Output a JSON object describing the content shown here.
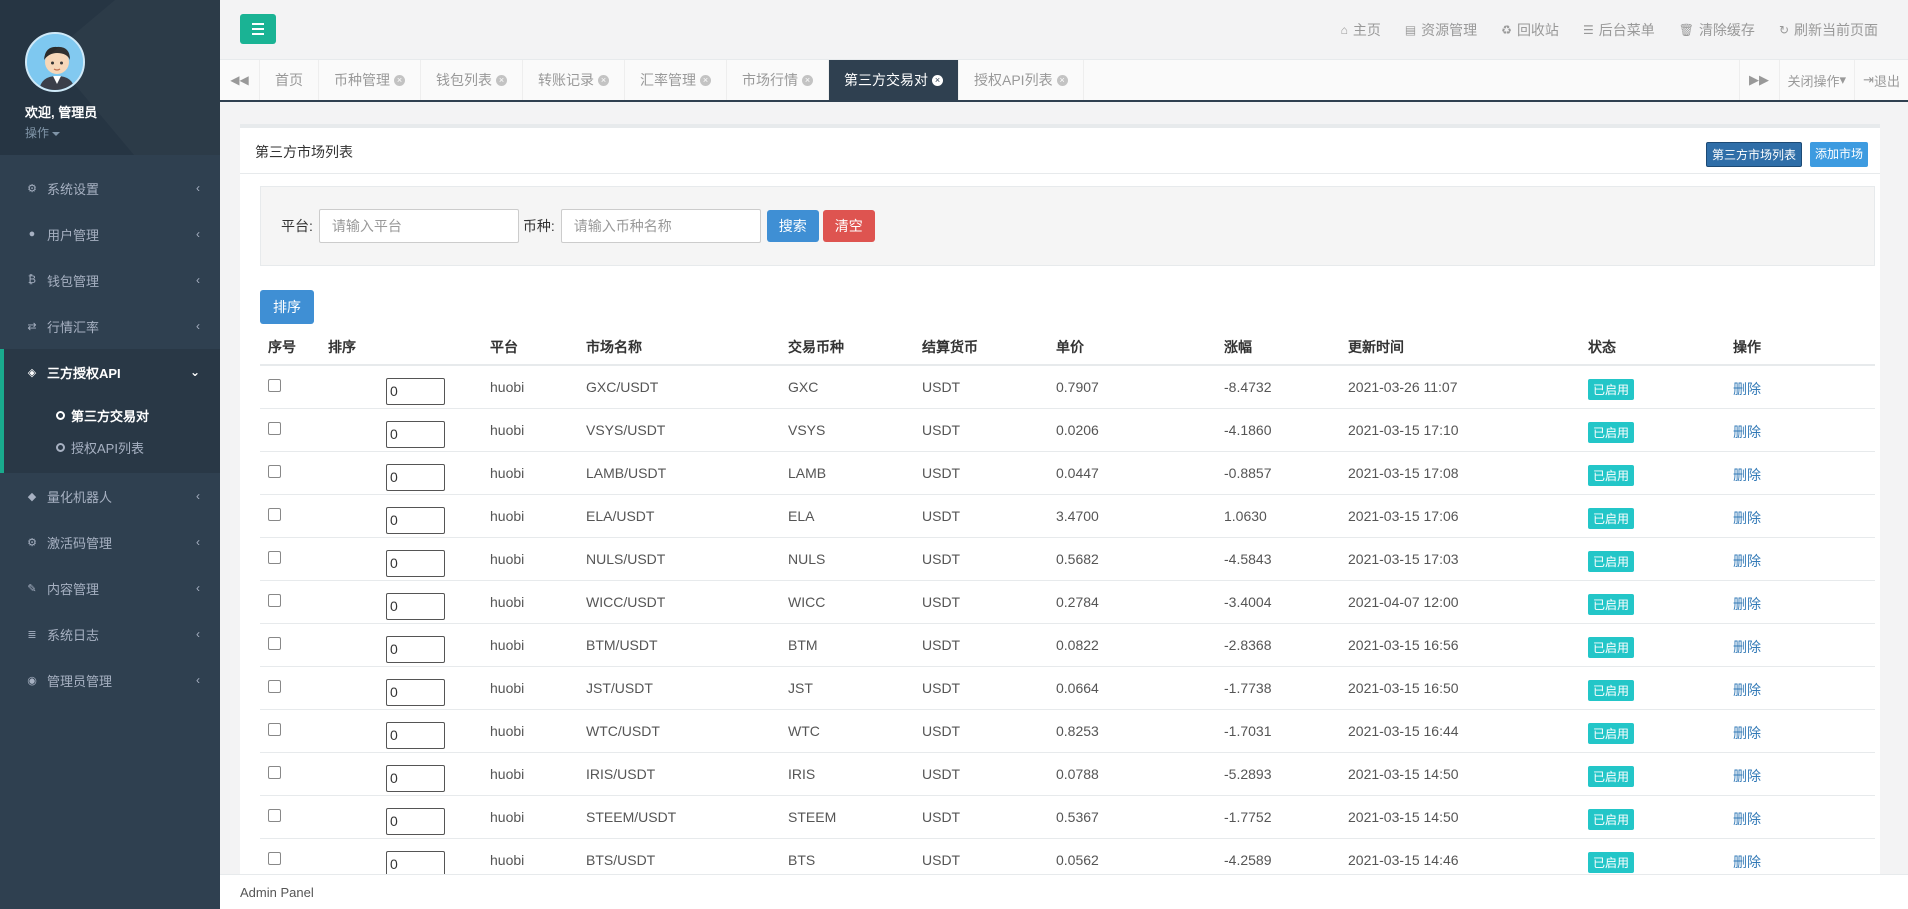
{
  "sidebar": {
    "welcome": "欢迎, 管理员",
    "ops_label": "操作",
    "menu": [
      {
        "label": "系统设置",
        "icon": "gears-icon"
      },
      {
        "label": "用户管理",
        "icon": "users-icon"
      },
      {
        "label": "钱包管理",
        "icon": "bitcoin-icon"
      },
      {
        "label": "行情汇率",
        "icon": "exchange-icon"
      },
      {
        "label": "三方授权API",
        "icon": "cube-icon"
      },
      {
        "label": "量化机器人",
        "icon": "robot-icon"
      },
      {
        "label": "激活码管理",
        "icon": "cog-icon"
      },
      {
        "label": "内容管理",
        "icon": "edit-icon"
      },
      {
        "label": "系统日志",
        "icon": "database-icon"
      },
      {
        "label": "管理员管理",
        "icon": "user-circle-icon"
      }
    ],
    "submenu": [
      "第三方交易对",
      "授权API列表"
    ]
  },
  "topbar": {
    "links": [
      "主页",
      "资源管理",
      "回收站",
      "后台菜单",
      "清除缓存",
      "刷新当前页面"
    ]
  },
  "tabs": [
    "首页",
    "币种管理",
    "钱包列表",
    "转账记录",
    "汇率管理",
    "市场行情",
    "第三方交易对",
    "授权API列表"
  ],
  "tabs_right": {
    "close_ops": "关闭操作",
    "logout": "退出"
  },
  "panel": {
    "title": "第三方市场列表",
    "btn_list": "第三方市场列表",
    "btn_add": "添加市场"
  },
  "search": {
    "platform_label": "平台:",
    "platform_placeholder": "请输入平台",
    "coin_label": "币种:",
    "coin_placeholder": "请输入币种名称",
    "search_btn": "搜索",
    "clear_btn": "清空"
  },
  "sort_btn": "排序",
  "table": {
    "headers": [
      "序号",
      "排序",
      "平台",
      "市场名称",
      "交易币种",
      "结算货币",
      "单价",
      "涨幅",
      "更新时间",
      "状态",
      "操作"
    ],
    "rows": [
      {
        "sort": "0",
        "platform": "huobi",
        "market": "GXC/USDT",
        "coin": "GXC",
        "settle": "USDT",
        "price": "0.7907",
        "change": "-8.4732",
        "time": "2021-03-26 11:07",
        "status": "已启用",
        "action": "删除"
      },
      {
        "sort": "0",
        "platform": "huobi",
        "market": "VSYS/USDT",
        "coin": "VSYS",
        "settle": "USDT",
        "price": "0.0206",
        "change": "-4.1860",
        "time": "2021-03-15 17:10",
        "status": "已启用",
        "action": "删除"
      },
      {
        "sort": "0",
        "platform": "huobi",
        "market": "LAMB/USDT",
        "coin": "LAMB",
        "settle": "USDT",
        "price": "0.0447",
        "change": "-0.8857",
        "time": "2021-03-15 17:08",
        "status": "已启用",
        "action": "删除"
      },
      {
        "sort": "0",
        "platform": "huobi",
        "market": "ELA/USDT",
        "coin": "ELA",
        "settle": "USDT",
        "price": "3.4700",
        "change": "1.0630",
        "time": "2021-03-15 17:06",
        "status": "已启用",
        "action": "删除"
      },
      {
        "sort": "0",
        "platform": "huobi",
        "market": "NULS/USDT",
        "coin": "NULS",
        "settle": "USDT",
        "price": "0.5682",
        "change": "-4.5843",
        "time": "2021-03-15 17:03",
        "status": "已启用",
        "action": "删除"
      },
      {
        "sort": "0",
        "platform": "huobi",
        "market": "WICC/USDT",
        "coin": "WICC",
        "settle": "USDT",
        "price": "0.2784",
        "change": "-3.4004",
        "time": "2021-04-07 12:00",
        "status": "已启用",
        "action": "删除"
      },
      {
        "sort": "0",
        "platform": "huobi",
        "market": "BTM/USDT",
        "coin": "BTM",
        "settle": "USDT",
        "price": "0.0822",
        "change": "-2.8368",
        "time": "2021-03-15 16:56",
        "status": "已启用",
        "action": "删除"
      },
      {
        "sort": "0",
        "platform": "huobi",
        "market": "JST/USDT",
        "coin": "JST",
        "settle": "USDT",
        "price": "0.0664",
        "change": "-1.7738",
        "time": "2021-03-15 16:50",
        "status": "已启用",
        "action": "删除"
      },
      {
        "sort": "0",
        "platform": "huobi",
        "market": "WTC/USDT",
        "coin": "WTC",
        "settle": "USDT",
        "price": "0.8253",
        "change": "-1.7031",
        "time": "2021-03-15 16:44",
        "status": "已启用",
        "action": "删除"
      },
      {
        "sort": "0",
        "platform": "huobi",
        "market": "IRIS/USDT",
        "coin": "IRIS",
        "settle": "USDT",
        "price": "0.0788",
        "change": "-5.2893",
        "time": "2021-03-15 14:50",
        "status": "已启用",
        "action": "删除"
      },
      {
        "sort": "0",
        "platform": "huobi",
        "market": "STEEM/USDT",
        "coin": "STEEM",
        "settle": "USDT",
        "price": "0.5367",
        "change": "-1.7752",
        "time": "2021-03-15 14:50",
        "status": "已启用",
        "action": "删除"
      },
      {
        "sort": "0",
        "platform": "huobi",
        "market": "BTS/USDT",
        "coin": "BTS",
        "settle": "USDT",
        "price": "0.0562",
        "change": "-4.2589",
        "time": "2021-03-15 14:46",
        "status": "已启用",
        "action": "删除"
      }
    ]
  },
  "footer": "Admin Panel"
}
